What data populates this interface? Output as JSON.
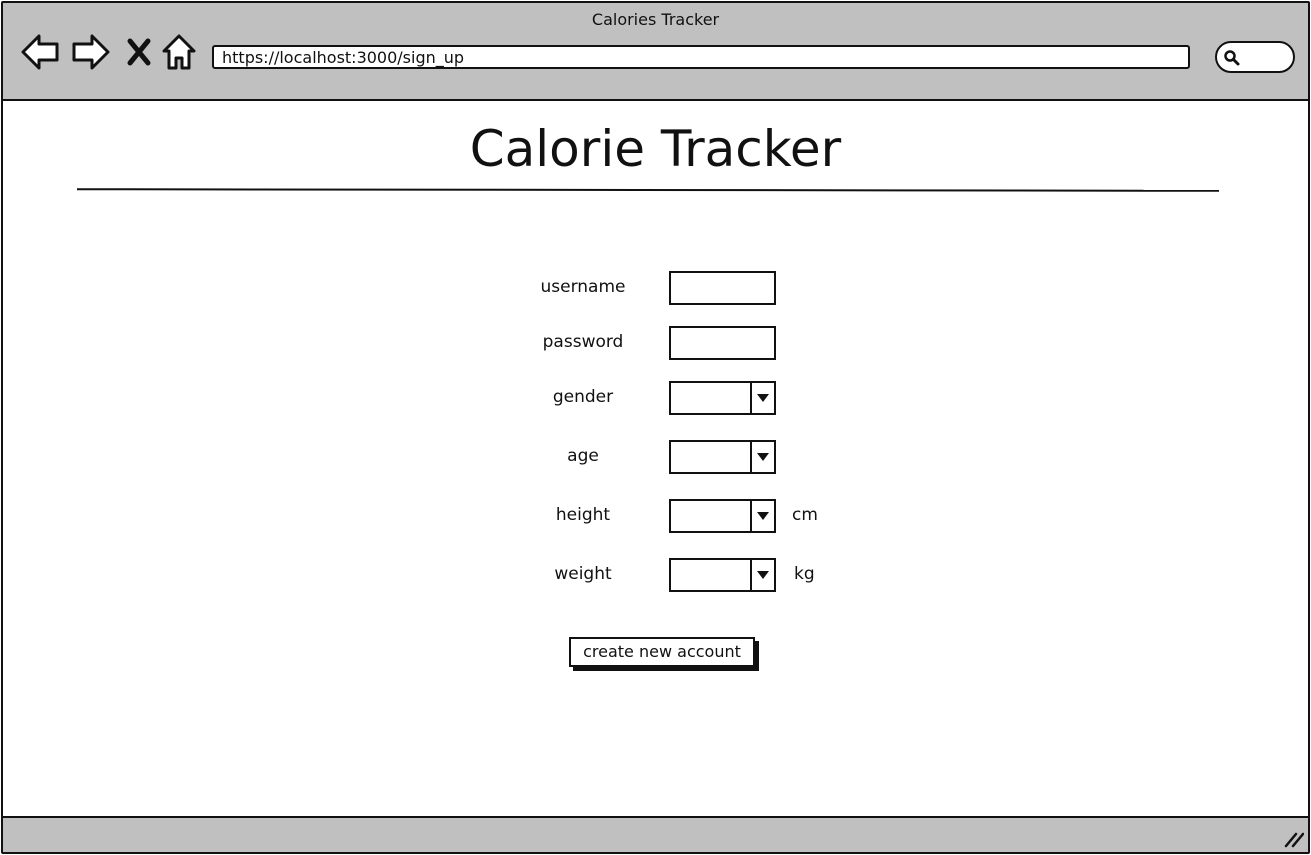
{
  "browser": {
    "window_title": "Calories Tracker",
    "url": "https://localhost:3000/sign_up",
    "nav_icons": [
      "back-icon",
      "forward-icon",
      "stop-icon",
      "home-icon"
    ],
    "search_icon": "search-icon"
  },
  "page": {
    "title": "Calorie Tracker"
  },
  "form": {
    "username_label": "username",
    "password_label": "password",
    "gender_label": "gender",
    "age_label": "age",
    "height_label": "height",
    "height_unit": "cm",
    "weight_label": "weight",
    "weight_unit": "kg",
    "submit_label": "create new account"
  },
  "colors": {
    "chrome": "#c0c0c0",
    "ink": "#111111",
    "background": "#ffffff"
  }
}
